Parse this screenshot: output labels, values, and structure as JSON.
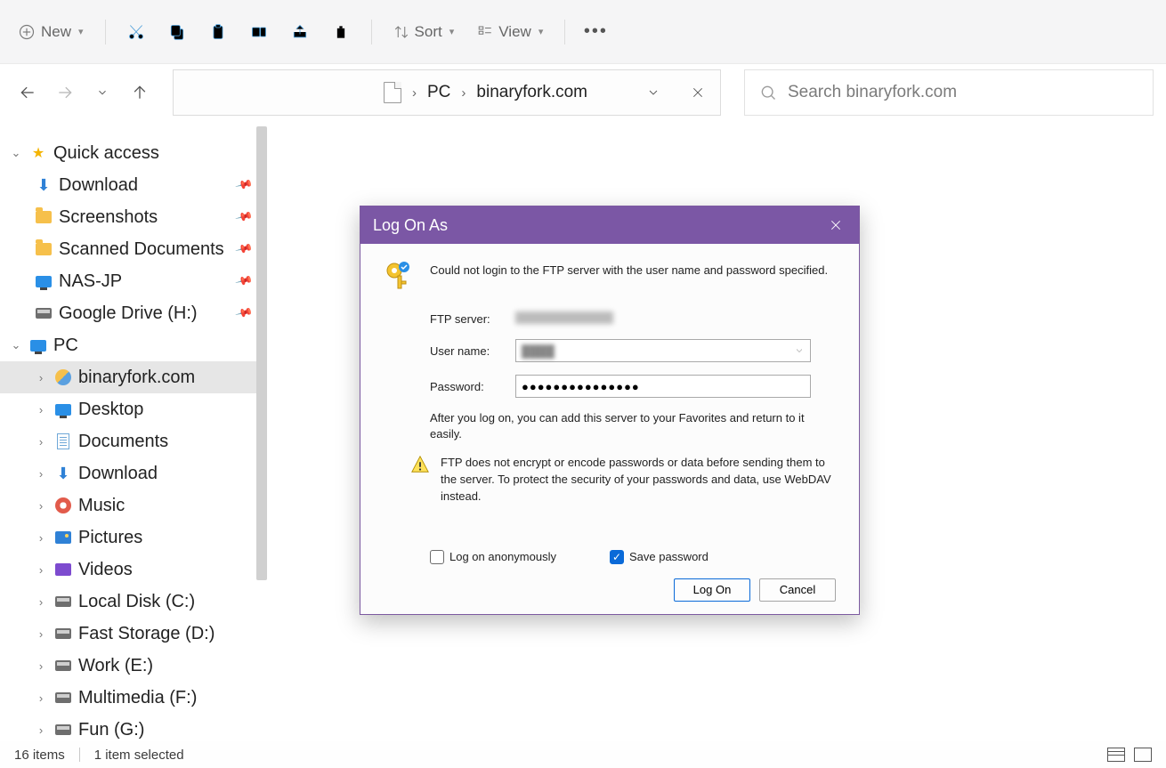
{
  "toolbar": {
    "new_label": "New",
    "sort_label": "Sort",
    "view_label": "View"
  },
  "breadcrumb": {
    "parts": [
      "PC",
      "binaryfork.com"
    ]
  },
  "search": {
    "placeholder": "Search binaryfork.com"
  },
  "sidebar": {
    "quick_access": "Quick access",
    "quick_items": [
      {
        "label": "Download",
        "icon": "download"
      },
      {
        "label": "Screenshots",
        "icon": "folder"
      },
      {
        "label": "Scanned Documents",
        "icon": "folder"
      },
      {
        "label": "NAS-JP",
        "icon": "monitor"
      },
      {
        "label": "Google Drive (H:)",
        "icon": "disk"
      }
    ],
    "pc_label": "PC",
    "pc_items": [
      {
        "label": "binaryfork.com",
        "icon": "globe",
        "selected": true
      },
      {
        "label": "Desktop",
        "icon": "monitor"
      },
      {
        "label": "Documents",
        "icon": "doc"
      },
      {
        "label": "Download",
        "icon": "download"
      },
      {
        "label": "Music",
        "icon": "music"
      },
      {
        "label": "Pictures",
        "icon": "pic"
      },
      {
        "label": "Videos",
        "icon": "vid"
      },
      {
        "label": "Local Disk (C:)",
        "icon": "disk"
      },
      {
        "label": "Fast Storage (D:)",
        "icon": "disk"
      },
      {
        "label": "Work (E:)",
        "icon": "disk"
      },
      {
        "label": "Multimedia (F:)",
        "icon": "disk"
      },
      {
        "label": "Fun (G:)",
        "icon": "disk"
      }
    ]
  },
  "dialog": {
    "title": "Log On As",
    "message": "Could not login to the FTP server with the user name and password specified.",
    "ftp_label": "FTP server:",
    "user_label": "User name:",
    "pass_label": "Password:",
    "pass_value": "●●●●●●●●●●●●●●●",
    "note": "After you log on, you can add this server to your Favorites and return to it easily.",
    "warning": "FTP does not encrypt or encode passwords or data before sending them to the server.  To protect the security of your passwords and data, use WebDAV instead.",
    "anon_label": "Log on anonymously",
    "save_label": "Save password",
    "logon_btn": "Log On",
    "cancel_btn": "Cancel"
  },
  "status": {
    "items": "16 items",
    "selected": "1 item selected"
  }
}
